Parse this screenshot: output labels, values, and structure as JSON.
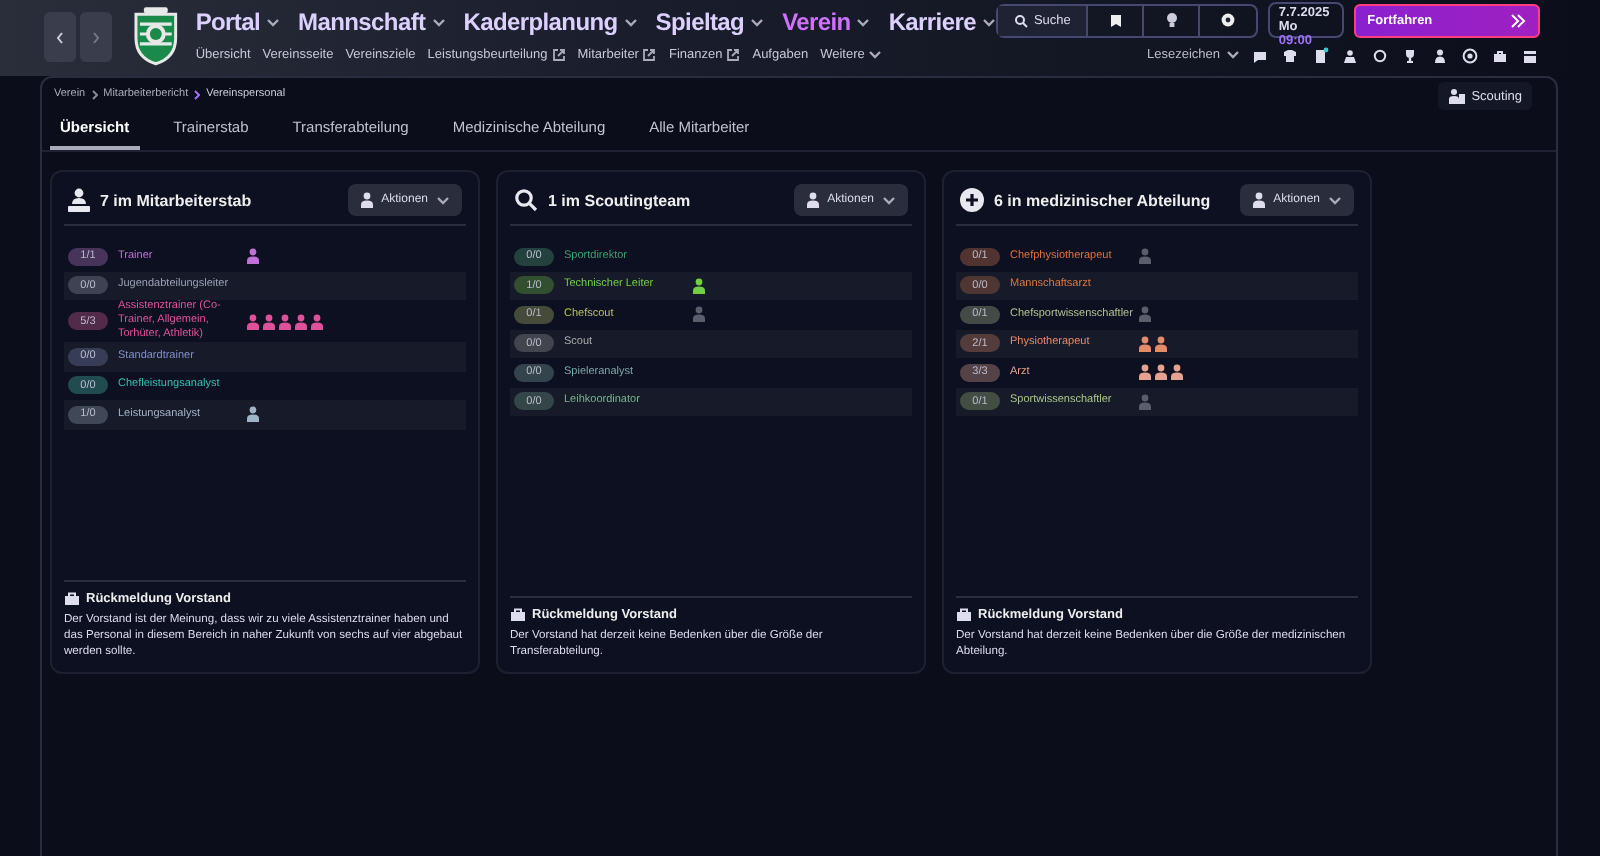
{
  "header": {
    "nav_menus": [
      {
        "label": "Portal",
        "selected": false
      },
      {
        "label": "Mannschaft",
        "selected": false
      },
      {
        "label": "Kaderplanung",
        "selected": false
      },
      {
        "label": "Spieltag",
        "selected": false
      },
      {
        "label": "Verein",
        "selected": true
      },
      {
        "label": "Karriere",
        "selected": false
      }
    ],
    "sub_menu": [
      {
        "label": "Übersicht",
        "external": false
      },
      {
        "label": "Vereinsseite",
        "external": false
      },
      {
        "label": "Vereinsziele",
        "external": false
      },
      {
        "label": "Leistungsbeurteilung",
        "external": true
      },
      {
        "label": "Mitarbeiter",
        "external": true
      },
      {
        "label": "Finanzen",
        "external": true
      },
      {
        "label": "Aufgaben",
        "external": false
      }
    ],
    "more": "Weitere",
    "search": "Suche",
    "date": "7.7.2025",
    "weekday": "Mo",
    "time": "09:00",
    "continue": "Fortfahren",
    "bookmarks": "Lesezeichen"
  },
  "breadcrumb": [
    "Verein",
    "Mitarbeiterbericht",
    "Vereinspersonal"
  ],
  "scouting_button": "Scouting",
  "tabs": [
    {
      "label": "Übersicht",
      "selected": true
    },
    {
      "label": "Trainerstab",
      "selected": false
    },
    {
      "label": "Transferabteilung",
      "selected": false
    },
    {
      "label": "Medizinische Abteilung",
      "selected": false
    },
    {
      "label": "Alle Mitarbeiter",
      "selected": false
    }
  ],
  "panels": [
    {
      "title": "7 im Mitarbeiterstab",
      "actions": "Aktionen",
      "roles": [
        {
          "count": "1/1",
          "name": "Trainer",
          "color": "#c070d8",
          "slots": [
            {
              "filled": true
            }
          ]
        },
        {
          "count": "0/0",
          "name": "Jugendabteilungsleiter",
          "color": "#9aa0b8"
        },
        {
          "count": "5/3",
          "name": "Assistenztrainer (Co-Trainer, Allgemein, Torhüter, Athletik)",
          "color": "#e0509a",
          "slots": [
            {
              "filled": true
            },
            {
              "filled": true
            },
            {
              "filled": true
            },
            {
              "filled": true
            },
            {
              "filled": true
            }
          ]
        },
        {
          "count": "0/0",
          "name": "Standardtrainer",
          "color": "#8090c8"
        },
        {
          "count": "0/0",
          "name": "Chefleistungsanalyst",
          "color": "#30c0b0"
        },
        {
          "count": "1/0",
          "name": "Leistungsanalyst",
          "color": "#a0b4c8",
          "slots": [
            {
              "filled": true
            }
          ]
        }
      ],
      "feedback_title": "Rückmeldung Vorstand",
      "feedback": "Der Vorstand ist der Meinung, dass wir zu viele Assistenztrainer haben und das Personal in diesem Bereich in naher Zukunft von sechs auf vier abgebaut werden sollte."
    },
    {
      "title": "1 im Scoutingteam",
      "actions": "Aktionen",
      "roles": [
        {
          "count": "0/0",
          "name": "Sportdirektor",
          "color": "#3aa070"
        },
        {
          "count": "1/0",
          "name": "Technischer Leiter",
          "color": "#70d040",
          "slots": [
            {
              "filled": true
            }
          ]
        },
        {
          "count": "0/1",
          "name": "Chefscout",
          "color": "#b8c060",
          "slots": [
            {
              "filled": false
            }
          ]
        },
        {
          "count": "0/0",
          "name": "Scout",
          "color": "#a8aca8"
        },
        {
          "count": "0/0",
          "name": "Spieleranalyst",
          "color": "#78a8a8"
        },
        {
          "count": "0/0",
          "name": "Leihkoordinator",
          "color": "#78b090"
        }
      ],
      "feedback_title": "Rückmeldung Vorstand",
      "feedback": "Der Vorstand hat derzeit keine Bedenken über die Größe der Transferabteilung."
    },
    {
      "title": "6 in medizinischer Abteilung",
      "actions": "Aktionen",
      "roles": [
        {
          "count": "0/1",
          "name": "Chefphysiotherapeut",
          "color": "#e07040",
          "slots": [
            {
              "filled": false
            }
          ]
        },
        {
          "count": "0/0",
          "name": "Mannschaftsarzt",
          "color": "#d87848"
        },
        {
          "count": "0/1",
          "name": "Chefsportwissenschaftler",
          "color": "#b0c090",
          "slots": [
            {
              "filled": false
            }
          ]
        },
        {
          "count": "2/1",
          "name": "Physiotherapeut",
          "color": "#e88a6a",
          "slots": [
            {
              "filled": true
            },
            {
              "filled": true
            }
          ]
        },
        {
          "count": "3/3",
          "name": "Arzt",
          "color": "#e8a090",
          "slots": [
            {
              "filled": true
            },
            {
              "filled": true
            },
            {
              "filled": true
            }
          ]
        },
        {
          "count": "0/1",
          "name": "Sportwissenschaftler",
          "color": "#a8c888",
          "slots": [
            {
              "filled": false
            }
          ]
        }
      ],
      "feedback_title": "Rückmeldung Vorstand",
      "feedback": "Der Vorstand hat derzeit keine Bedenken über die Größe der medizinischen Abteilung."
    }
  ]
}
